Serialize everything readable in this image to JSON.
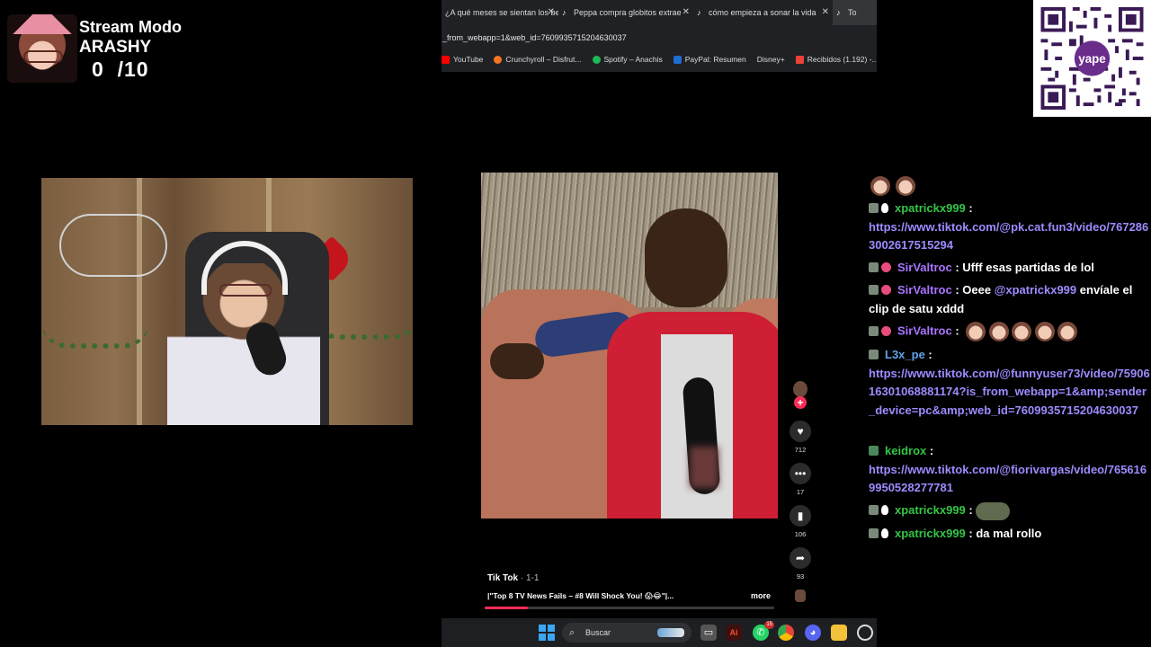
{
  "overlay": {
    "title": "Stream Modo",
    "name": "ARASHY",
    "count": "0  /10"
  },
  "browser": {
    "tabs": [
      {
        "label": "¿A qué meses se sientan los be",
        "icon": "page-icon"
      },
      {
        "label": "Peppa compra globitos extrae",
        "icon": "tiktok-icon"
      },
      {
        "label": "cómo empieza a sonar la vida",
        "icon": "tiktok-icon"
      },
      {
        "label": "To",
        "icon": "tiktok-icon"
      }
    ],
    "address": "_from_webapp=1&web_id=7609935715204630037",
    "bookmarks": [
      {
        "label": "YouTube",
        "color": "#ff0000"
      },
      {
        "label": "Crunchyroll – Disfrut...",
        "color": "#f47521"
      },
      {
        "label": "Spotify – Anachis",
        "color": "#1db954"
      },
      {
        "label": "PayPal: Resumen",
        "color": "#1e6fd0"
      },
      {
        "label": "Disney+",
        "color": "#1b2a6b"
      },
      {
        "label": "Recibidos (1.192) -...",
        "color": "#ea4335"
      }
    ]
  },
  "qr": {
    "brand": "yape",
    "accent": "#6b2d8c"
  },
  "video": {
    "author": "Tik Tok",
    "author_meta": " · 1-1",
    "description": "|\"Top 8 TV News Fails – #8 Will Shock You! 😱😂\"|...",
    "more_label": "more",
    "progress": 0.15,
    "likes": "712",
    "comments": "17",
    "saves": "106",
    "shares": "93"
  },
  "taskbar": {
    "search_placeholder": "Buscar",
    "whatsapp_badge": "15"
  },
  "chat": {
    "messages": [
      {
        "user": "xpatrickx999",
        "color": "green",
        "separator": " :",
        "text": "",
        "link": "https://www.tiktok.com/@pk.cat.fun3/video/7672863002617515294"
      },
      {
        "user": "SirValtroc",
        "color": "purple",
        "separator": " : ",
        "text": "Ufff esas partidas de lol"
      },
      {
        "user": "SirValtroc",
        "color": "purple",
        "separator": " : ",
        "text_before": "Oeee ",
        "mention": "@xpatrickx999",
        "text_after": " envíale el clip de satu xddd"
      },
      {
        "user": "SirValtroc",
        "color": "purple",
        "separator": " : "
      },
      {
        "user": "L3x_pe",
        "color": "blue",
        "separator": " :",
        "link": "https://www.tiktok.com/@funnyuser73/video/7590616301068881174?is_from_webapp=1&amp;sender_device=pc&amp;web_id=7609935715204630037"
      },
      {
        "user": "keidrox",
        "color": "green",
        "separator": " :",
        "link": "https://www.tiktok.com/@fiorivargas/video/7656169950528277781"
      },
      {
        "user": "xpatrickx999",
        "color": "green",
        "separator": " : "
      },
      {
        "user": "xpatrickx999",
        "color": "green",
        "separator": " : ",
        "text": "da mal rollo"
      }
    ]
  }
}
